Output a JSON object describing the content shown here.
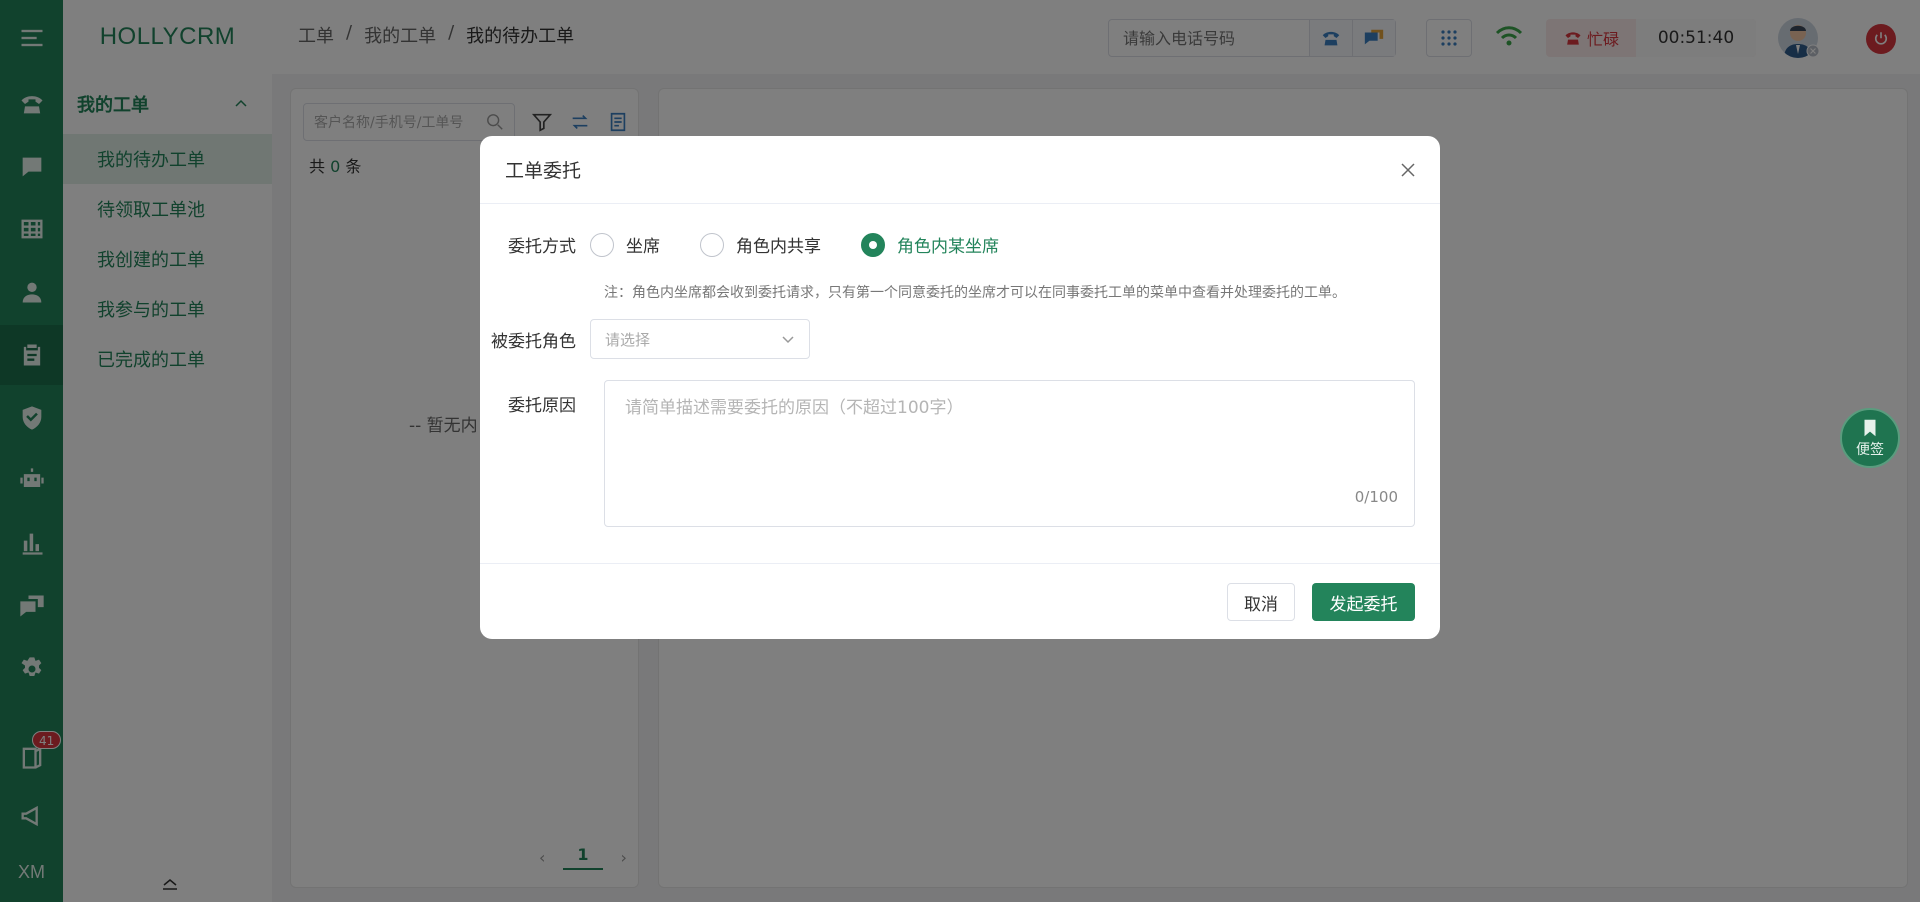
{
  "app": {
    "brand": "HOLLYCRM"
  },
  "rail": {
    "badge_count": "41",
    "bottom_text": "XM"
  },
  "sidebar": {
    "group_label": "我的工单",
    "items": [
      {
        "label": "我的待办工单"
      },
      {
        "label": "待领取工单池"
      },
      {
        "label": "我创建的工单"
      },
      {
        "label": "我参与的工单"
      },
      {
        "label": "已完成的工单"
      }
    ]
  },
  "header": {
    "breadcrumb": [
      "工单",
      "我的工单",
      "我的待办工单"
    ],
    "breadcrumb_sep": "/",
    "phone_placeholder": "请输入电话号码",
    "status_label": "忙碌",
    "timer": "00:51:40"
  },
  "list": {
    "search_placeholder": "客户名称/手机号/工单号",
    "count_prefix": "共",
    "count": "0",
    "count_suffix": "条",
    "empty_text": "-- 暂无内",
    "page": "1"
  },
  "note_button": {
    "label": "便签"
  },
  "modal": {
    "title": "工单委托",
    "method_label": "委托方式",
    "methods": [
      {
        "label": "坐席",
        "selected": false
      },
      {
        "label": "角色内共享",
        "selected": false
      },
      {
        "label": "角色内某坐席",
        "selected": true
      }
    ],
    "hint": "注：角色内坐席都会收到委托请求，只有第一个同意委托的坐席才可以在同事委托工单的菜单中查看并处理委托的工单。",
    "role_label": "被委托角色",
    "role_placeholder": "请选择",
    "reason_label": "委托原因",
    "reason_placeholder": "请简单描述需要委托的原因（不超过100字）",
    "reason_count": "0/100",
    "cancel_label": "取消",
    "submit_label": "发起委托"
  },
  "colors": {
    "brand": "#23845b",
    "danger": "#d9363e"
  }
}
